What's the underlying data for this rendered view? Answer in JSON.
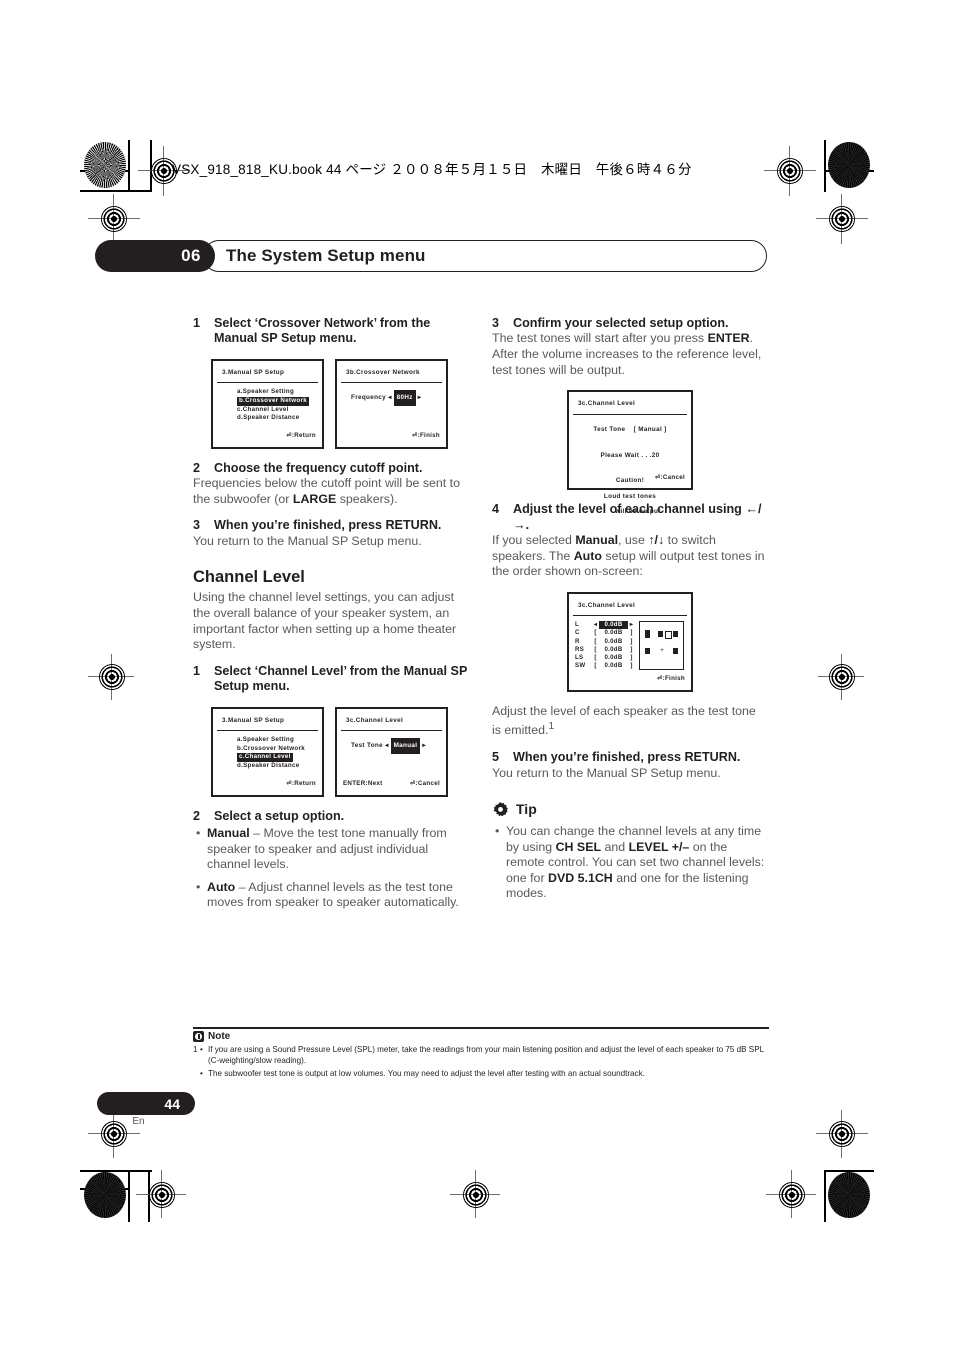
{
  "header": {
    "running_head": "VSX_918_818_KU.book 44 ページ ２００８年５月１５日　木曜日　午後６時４６分"
  },
  "chapter": {
    "number": "06",
    "title": "The System Setup menu"
  },
  "left_column": {
    "step1": {
      "num": "1",
      "text": "Select ‘Crossover Network’ from the Manual SP Setup menu."
    },
    "osd_manual_sp_setup": {
      "header": "3.Manual SP Setup",
      "items": [
        {
          "label": "a.Speaker Setting",
          "highlighted": false
        },
        {
          "label": "b.Crossover Network",
          "highlighted": true
        },
        {
          "label": "c.Channel Level",
          "highlighted": false
        },
        {
          "label": "d.Speaker Distance",
          "highlighted": false
        }
      ],
      "footer": ":Return"
    },
    "osd_crossover_network": {
      "header": "3b.Crossover Network",
      "field_label": "Frequency",
      "field_value": "80Hz",
      "footer": ":Finish"
    },
    "step2": {
      "num": "2",
      "title": "Choose the frequency cutoff point.",
      "body_pre": "Frequencies below the cutoff point will be sent to the subwoofer (or ",
      "body_bold": "LARGE",
      "body_post": " speakers)."
    },
    "step3": {
      "num": "3",
      "title": "When you’re finished, press RETURN.",
      "body": "You return to the Manual SP Setup menu."
    },
    "section_heading": "Channel Level",
    "section_body": "Using the channel level settings, you can adjust the overall balance of your speaker system, an important factor when setting up a home theater system.",
    "step1b": {
      "num": "1",
      "text": "Select ‘Channel Level’ from the Manual SP Setup menu."
    },
    "osd_manual_sp_setup2": {
      "header": "3.Manual SP Setup",
      "items": [
        {
          "label": "a.Speaker Setting",
          "highlighted": false
        },
        {
          "label": "b.Crossover Network",
          "highlighted": false
        },
        {
          "label": "c.Channel Level",
          "highlighted": true
        },
        {
          "label": "d.Speaker Distance",
          "highlighted": false
        }
      ],
      "footer": ":Return"
    },
    "osd_channel_level_select": {
      "header": "3c.Channel Level",
      "field_label": "Test Tone",
      "field_value": "Manual",
      "footer_left": "ENTER:Next",
      "footer_right": ":Cancel"
    },
    "step2b": {
      "num": "2",
      "title": "Select a setup option.",
      "options": [
        {
          "name": "Manual",
          "desc": " – Move the test tone manually from speaker to speaker and adjust individual channel levels."
        },
        {
          "name": "Auto",
          "desc": " – Adjust channel levels as the test tone moves from speaker to speaker automatically."
        }
      ]
    }
  },
  "right_column": {
    "step3": {
      "num": "3",
      "title": "Confirm your selected setup option.",
      "body_pre": "The test tones will start after you press ",
      "body_bold": "ENTER",
      "body_post": ". After the volume increases to the reference level, test tones will be output."
    },
    "osd_channel_level_wait": {
      "header": "3c.Channel Level",
      "test_tone_label": "Test Tone",
      "test_tone_value": "[ Manual ]",
      "wait_text": "Please Wait . . .20",
      "caution_line1": "Caution!",
      "caution_line2": "Loud test tones",
      "caution_line3": "will be output.",
      "footer": ":Cancel"
    },
    "step4": {
      "num": "4",
      "title_pre": "Adjust the level of each channel using ",
      "title_arrows": "←/→",
      "title_post": ".",
      "body_pre": "If you selected ",
      "body_b1": "Manual",
      "body_mid1": ", use ",
      "body_arrows": "↑/↓",
      "body_mid2": " to switch speakers. The ",
      "body_b2": "Auto",
      "body_post": " setup will output test tones in the order shown on-screen:"
    },
    "osd_channel_level_adjust": {
      "header": "3c.Channel Level",
      "channels": [
        {
          "label": "L",
          "value": "0.0dB",
          "selected": true
        },
        {
          "label": "C",
          "value": "0.0dB",
          "selected": false
        },
        {
          "label": "R",
          "value": "0.0dB",
          "selected": false
        },
        {
          "label": "RS",
          "value": "0.0dB",
          "selected": false
        },
        {
          "label": "LS",
          "value": "0.0dB",
          "selected": false
        },
        {
          "label": "SW",
          "value": "0.0dB",
          "selected": false
        }
      ],
      "footer": ":Finish"
    },
    "after_osd_body": "Adjust the level of each speaker as the test tone is emitted.",
    "after_osd_footnote": "1",
    "step5": {
      "num": "5",
      "title": "When you’re finished, press RETURN.",
      "body": "You return to the Manual SP Setup menu."
    },
    "tip": {
      "title": "Tip",
      "items": [
        {
          "pre": "You can change the channel levels at any time by using ",
          "b1": "CH SEL",
          "mid1": " and ",
          "b2": "LEVEL +/–",
          "mid2": " on the remote control. You can set two channel levels: one for ",
          "b3": "DVD 5.1CH",
          "post": " and one for the listening modes."
        }
      ]
    }
  },
  "note": {
    "title": "Note",
    "footnote_marker": "1",
    "items": [
      "If you are using a Sound Pressure Level (SPL) meter, take the readings from your main listening position and adjust the level of each speaker to 75 dB SPL (C-weighting/slow reading).",
      "The subwoofer test tone is output at low volumes. You may need to adjust the level after testing with an actual soundtrack."
    ]
  },
  "footer": {
    "page_number": "44",
    "language": "En"
  }
}
